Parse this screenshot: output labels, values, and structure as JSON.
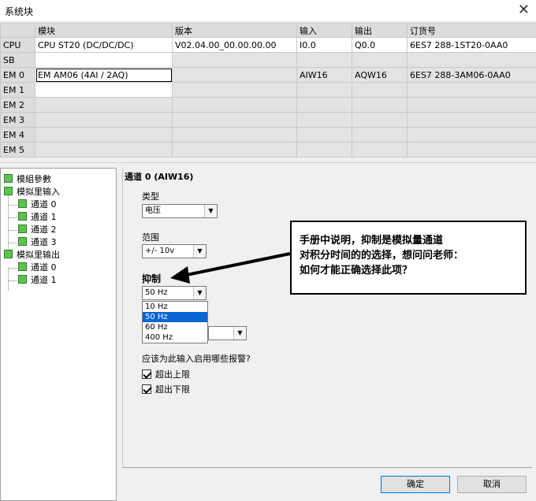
{
  "window": {
    "title": "系统块",
    "close_glyph": "✕"
  },
  "table": {
    "headers": [
      "",
      "模块",
      "版本",
      "输入",
      "输出",
      "订货号"
    ],
    "rows": [
      [
        "CPU",
        "CPU ST20 (DC/DC/DC)",
        "V02.04.00_00.00.00.00",
        "I0.0",
        "Q0.0",
        "6ES7 288-1ST20-0AA0"
      ],
      [
        "SB",
        "",
        "",
        "",
        "",
        ""
      ],
      [
        "EM 0",
        "EM AM06 (4AI / 2AQ)",
        "",
        "AIW16",
        "AQW16",
        "6ES7 288-3AM06-0AA0"
      ],
      [
        "EM 1",
        "",
        "",
        "",
        "",
        ""
      ],
      [
        "EM 2",
        "",
        "",
        "",
        "",
        ""
      ],
      [
        "EM 3",
        "",
        "",
        "",
        "",
        ""
      ],
      [
        "EM 4",
        "",
        "",
        "",
        "",
        ""
      ],
      [
        "EM 5",
        "",
        "",
        "",
        "",
        ""
      ]
    ]
  },
  "tree": {
    "items": [
      {
        "label": "模組參數",
        "level": 0
      },
      {
        "label": "模拟里输入",
        "level": 0
      },
      {
        "label": "通道 0",
        "level": 1
      },
      {
        "label": "通道 1",
        "level": 1
      },
      {
        "label": "通道 2",
        "level": 1
      },
      {
        "label": "通道 3",
        "level": 1
      },
      {
        "label": "模拟里输出",
        "level": 0
      },
      {
        "label": "通道 0",
        "level": 1
      },
      {
        "label": "通道 1",
        "level": 1
      }
    ]
  },
  "channel": {
    "title": "通道 0 (AIW16)",
    "type_label": "类型",
    "type_value": "电压",
    "range_label": "范围",
    "range_value": "+/- 10v",
    "suppress_label": "抑制",
    "suppress_value": "50 Hz",
    "suppress_options": [
      "10 Hz",
      "50 Hz",
      "60 Hz",
      "400 Hz"
    ],
    "suppress_selected": 1,
    "alarm_question": "应该为此输入启用哪些报警?",
    "alarm_upper": "超出上限",
    "alarm_lower": "超出下限"
  },
  "buttons": {
    "ok": "确定",
    "cancel": "取消"
  },
  "annotation": {
    "lines": [
      "手册中说明，抑制是模拟量通道",
      "对积分时间的的选择，想问问老师：",
      "如何才能正确选择此项？"
    ]
  },
  "icons": {
    "close": "close-icon",
    "tree_node": "green-square-icon",
    "dropdown": "chevron-down-icon",
    "check": "checkmark-icon"
  },
  "colors": {
    "highlight": "#0a64d2",
    "node_green": "#5fc24f"
  }
}
